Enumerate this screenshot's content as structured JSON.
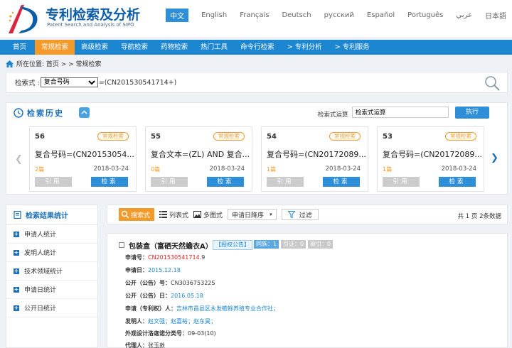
{
  "header": {
    "title": "专利检索及分析",
    "subtitle": "Patent Search and Analysis of SIPO",
    "languages": [
      "中文",
      "English",
      "Français",
      "Deutsch",
      "русский",
      "Español",
      "Português",
      "عربي",
      "日本語"
    ],
    "active_language": "中文"
  },
  "nav": {
    "items": [
      "首页",
      "常规检索",
      "高级检索",
      "导航检索",
      "药物检索",
      "热门工具",
      "命令行检索",
      "> 专利分析",
      "> 专利服务"
    ],
    "active": "常规检索"
  },
  "breadcrumb": {
    "text": "所在位置: 首页 > > 常规检索"
  },
  "query": {
    "label": "检索式 :",
    "field_selected": "复合号码",
    "expression": "=(CN201530541714+)"
  },
  "history": {
    "title": "检索历史",
    "operation_label": "检索式运算",
    "operation_value": "检索式运算",
    "execute_label": "执行",
    "cards": [
      {
        "num": "56",
        "tag": "常规检索",
        "query": "复合号码=(CN20153054...",
        "count": "2篇",
        "date": "2018-03-24",
        "cite": "引用",
        "search": "检索"
      },
      {
        "num": "55",
        "tag": "常规检索",
        "query": "复合文本=(ZL) AND 复合...",
        "count": "0篇",
        "date": "2018-03-24",
        "cite": "引用",
        "search": "检索"
      },
      {
        "num": "54",
        "tag": "常规检索",
        "query": "复合号码=(CN20172089...",
        "count": "1篇",
        "date": "2018-03-24",
        "cite": "引用",
        "search": "检索"
      },
      {
        "num": "53",
        "tag": "常规检索",
        "query": "复合号码=(CN20172089...",
        "count": "1篇",
        "date": "2018-03-24",
        "cite": "引用",
        "search": "检索"
      }
    ]
  },
  "stats": {
    "title": "检索结果统计",
    "items": [
      "申请人统计",
      "发明人统计",
      "技术领域统计",
      "申请日统计",
      "公开日统计"
    ]
  },
  "toolbar": {
    "summary": "搜索式",
    "list": "列表式",
    "multi": "多图式",
    "sort": "申请日降序",
    "filter": "过滤",
    "page_info": "共 1 页 2条数据"
  },
  "result": {
    "title": "包装盒（富硒天然蟾衣A）",
    "badge_grant": "【授权公告】",
    "badge_family": "同族：1",
    "badge_cite": "引证：0",
    "badge_cited": "被引：0",
    "app_no_label": "申请号：",
    "app_no_highlight": "CN201530541714",
    "app_no_suffix": ".9",
    "app_date_label": "申请日：",
    "app_date": "2015.12.18",
    "pub_no_label": "公开（公告）号：",
    "pub_no": "CN303675322S",
    "pub_date_label": "公开（公告）日：",
    "pub_date": "2016.05.18",
    "applicant_label": "申请（专利权）人：",
    "applicant": "吉林市昌邑区永发蟾蜍养殖专业合作社；",
    "inventor_label": "发明人：",
    "inventors": "赵文强；赵嘉裕；赵东昊；",
    "design_class_label": "外观设计洛迦诺分类号：",
    "design_class": "09-03(10)",
    "agent_label": "代理人：",
    "agent": "张玉敦"
  }
}
